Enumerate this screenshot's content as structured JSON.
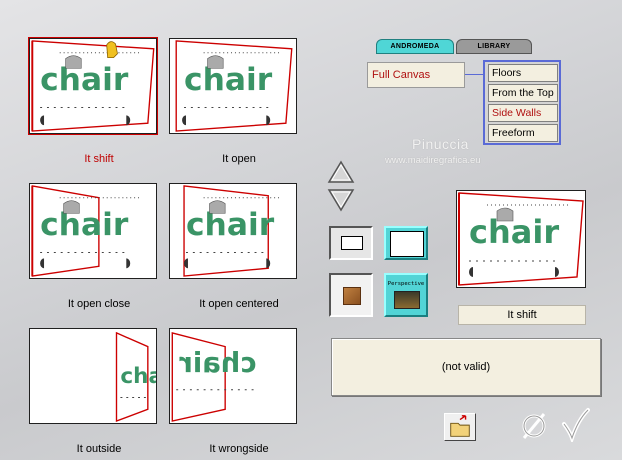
{
  "presets": [
    {
      "label": "It shift",
      "selected": true
    },
    {
      "label": "It open",
      "selected": false
    },
    {
      "label": "It open close",
      "selected": false
    },
    {
      "label": "It open centered",
      "selected": false
    },
    {
      "label": "It outside",
      "selected": false
    },
    {
      "label": "It wrongside",
      "selected": false
    }
  ],
  "preview_word": "chair",
  "tabs": {
    "andromeda": "ANDROMEDA",
    "library": "LIBRARY"
  },
  "category": {
    "selected": "Full Canvas"
  },
  "options": [
    "Floors",
    "From the Top",
    "Side Walls",
    "Freeform"
  ],
  "selected_option": "Side Walls",
  "watermark": {
    "name": "Pinuccia",
    "url": "www.maidiregrafica.eu"
  },
  "preview_label": "It shift",
  "perspective_label": "Perspective",
  "status_text": "(not valid)",
  "colors": {
    "accent_red": "#cc0000",
    "panel_bg": "#f3efe0",
    "tab_active": "#4fd6d6",
    "option_border": "#5a6ad6",
    "chair_green": "#3a9466"
  }
}
